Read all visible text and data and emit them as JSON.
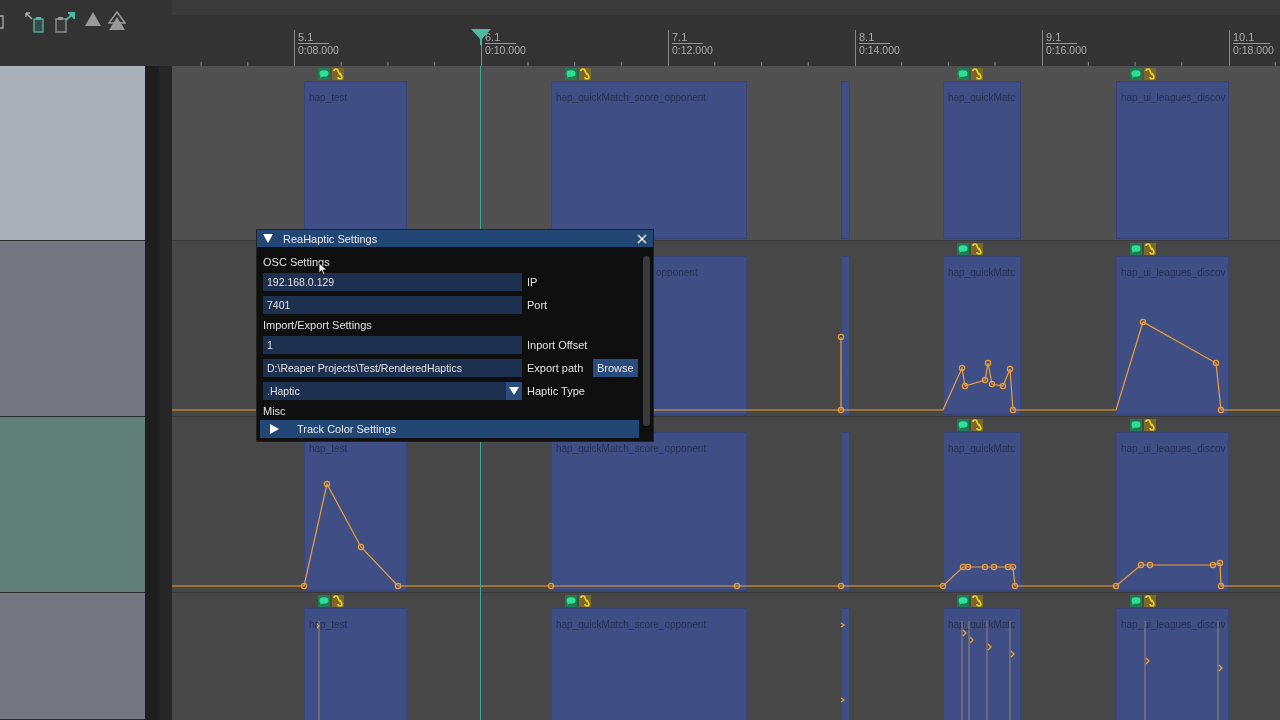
{
  "ruler": {
    "marks": [
      {
        "bar": "5.1",
        "time": "0:08.000"
      },
      {
        "bar": "6.1",
        "time": "0:10.000"
      },
      {
        "bar": "7.1",
        "time": "0:12.000"
      },
      {
        "bar": "8.1",
        "time": "0:14.000"
      },
      {
        "bar": "9.1",
        "time": "0:16.000"
      },
      {
        "bar": "10.1",
        "time": "0:18.000"
      }
    ]
  },
  "tracks": [
    {
      "color": "#a9b0b7",
      "kind": "plain",
      "items": [
        {
          "label": "hap_test",
          "badges": true
        },
        {
          "label": "hap_quickMatch_score_opponent",
          "badges": true
        },
        {
          "badges": false
        },
        {
          "label": "hap_quickMatc",
          "badges": true
        },
        {
          "label": "hap_ui_leagues_discov",
          "badges": true
        }
      ]
    },
    {
      "color": "#737681",
      "kind": "envelope",
      "items": [
        {
          "label": "opponent"
        },
        {
          "badges": false
        },
        {
          "label": "hap_quickMatc",
          "badges": true
        },
        {
          "label": "hap_ui_leagues_discov",
          "badges": true
        }
      ]
    },
    {
      "color": "#5f7f76",
      "kind": "envelope",
      "items": [
        {
          "label": "hap_test"
        },
        {
          "label": "hap_quickMatch_score_opponent"
        },
        {
          "badges": false
        },
        {
          "label": "hap_quickMatc",
          "badges": true
        },
        {
          "label": "hap_ui_leagues_discov",
          "badges": true
        }
      ]
    },
    {
      "color": "#737681",
      "kind": "markers",
      "items": [
        {
          "label": "hap_test",
          "badges": true
        },
        {
          "label": "hap_quickMatch_score_opponent",
          "badges": true
        },
        {
          "badges": false
        },
        {
          "label": "hap_quickMatc",
          "badges": true
        },
        {
          "label": "hap_ui_leagues_discov",
          "badges": true
        }
      ]
    }
  ],
  "dialog": {
    "title": "ReaHaptic Settings",
    "rows": [
      {
        "kind": "heading",
        "text": "OSC Settings"
      },
      {
        "kind": "input",
        "value": "192.168.0.129",
        "label": "IP"
      },
      {
        "kind": "input",
        "value": "7401",
        "label": "Port"
      },
      {
        "kind": "heading",
        "text": "Import/Export Settings"
      },
      {
        "kind": "input",
        "value": "1",
        "label": "Inport Offset"
      },
      {
        "kind": "input",
        "value": "D:\\Reaper Projects\\Test/RenderedHaptics",
        "label": "Export path",
        "button": "Browse"
      },
      {
        "kind": "select",
        "value": ".Haptic",
        "label": "Haptic Type"
      },
      {
        "kind": "heading",
        "text": "Misc"
      },
      {
        "kind": "collapser",
        "text": "Track Color Settings",
        "expanded": false
      }
    ]
  }
}
